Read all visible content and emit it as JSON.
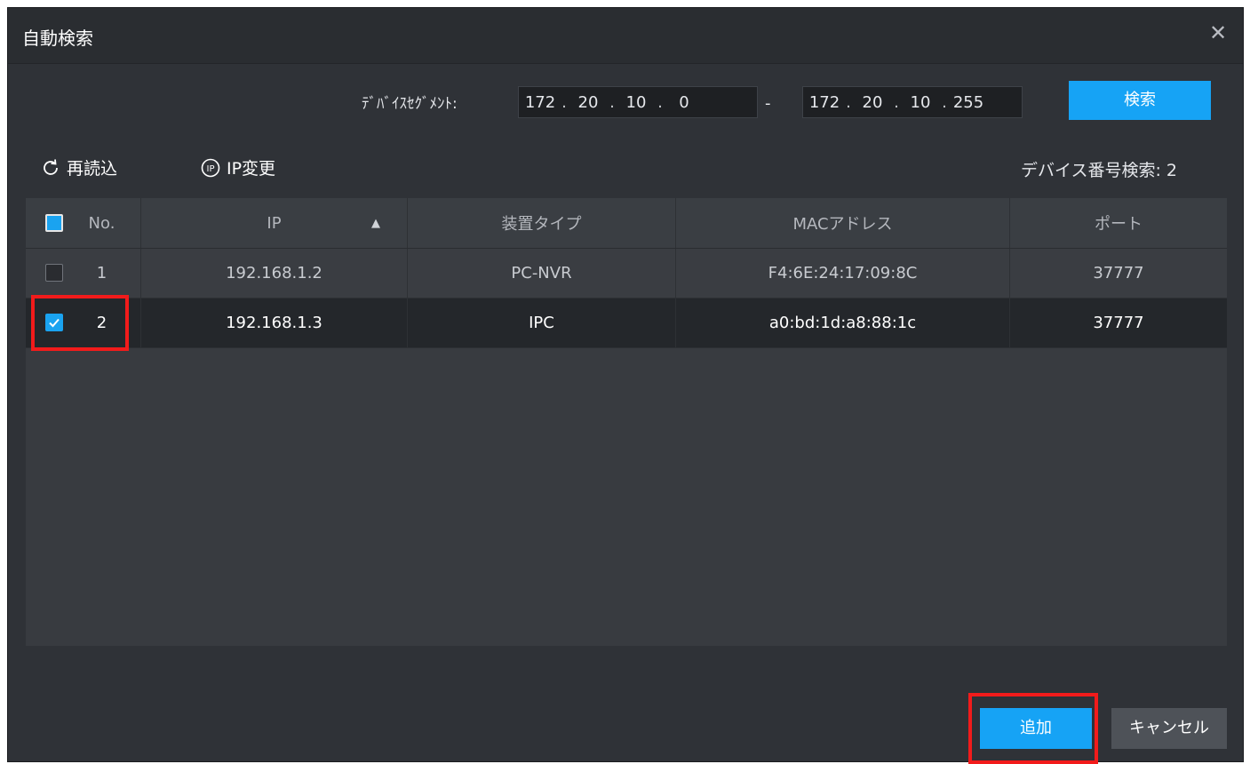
{
  "dialog": {
    "title": "自動検索",
    "close_glyph": "✕"
  },
  "segment": {
    "label": "ﾃﾞﾊﾞｲｽｾｸﾞﾒﾝﾄ:",
    "start": [
      "172",
      "20",
      "10",
      "0"
    ],
    "end": [
      "172",
      "20",
      "10",
      "255"
    ],
    "separator": "-",
    "search_button": "検索"
  },
  "toolbar": {
    "refresh_label": "再読込",
    "refresh_icon": "refresh-icon",
    "ip_change_label": "IP変更",
    "ip_change_icon": "ip-icon",
    "device_count_label": "デバイス番号検索:",
    "device_count": "2"
  },
  "table": {
    "columns": [
      "No.",
      "IP",
      "装置タイプ",
      "MACアドレス",
      "ポート"
    ],
    "sort_indicator": "▲",
    "rows": [
      {
        "no": "1",
        "ip": "192.168.1.2",
        "type": "PC-NVR",
        "mac": "F4:6E:24:17:09:8C",
        "port": "37777",
        "checked": false
      },
      {
        "no": "2",
        "ip": "192.168.1.3",
        "type": "IPC",
        "mac": "a0:bd:1d:a8:88:1c",
        "port": "37777",
        "checked": true
      }
    ]
  },
  "footer": {
    "add_button": "追加",
    "cancel_button": "キャンセル"
  },
  "colors": {
    "accent": "#16a3f5",
    "highlight": "#f21b1b",
    "background": "#2f3237"
  }
}
